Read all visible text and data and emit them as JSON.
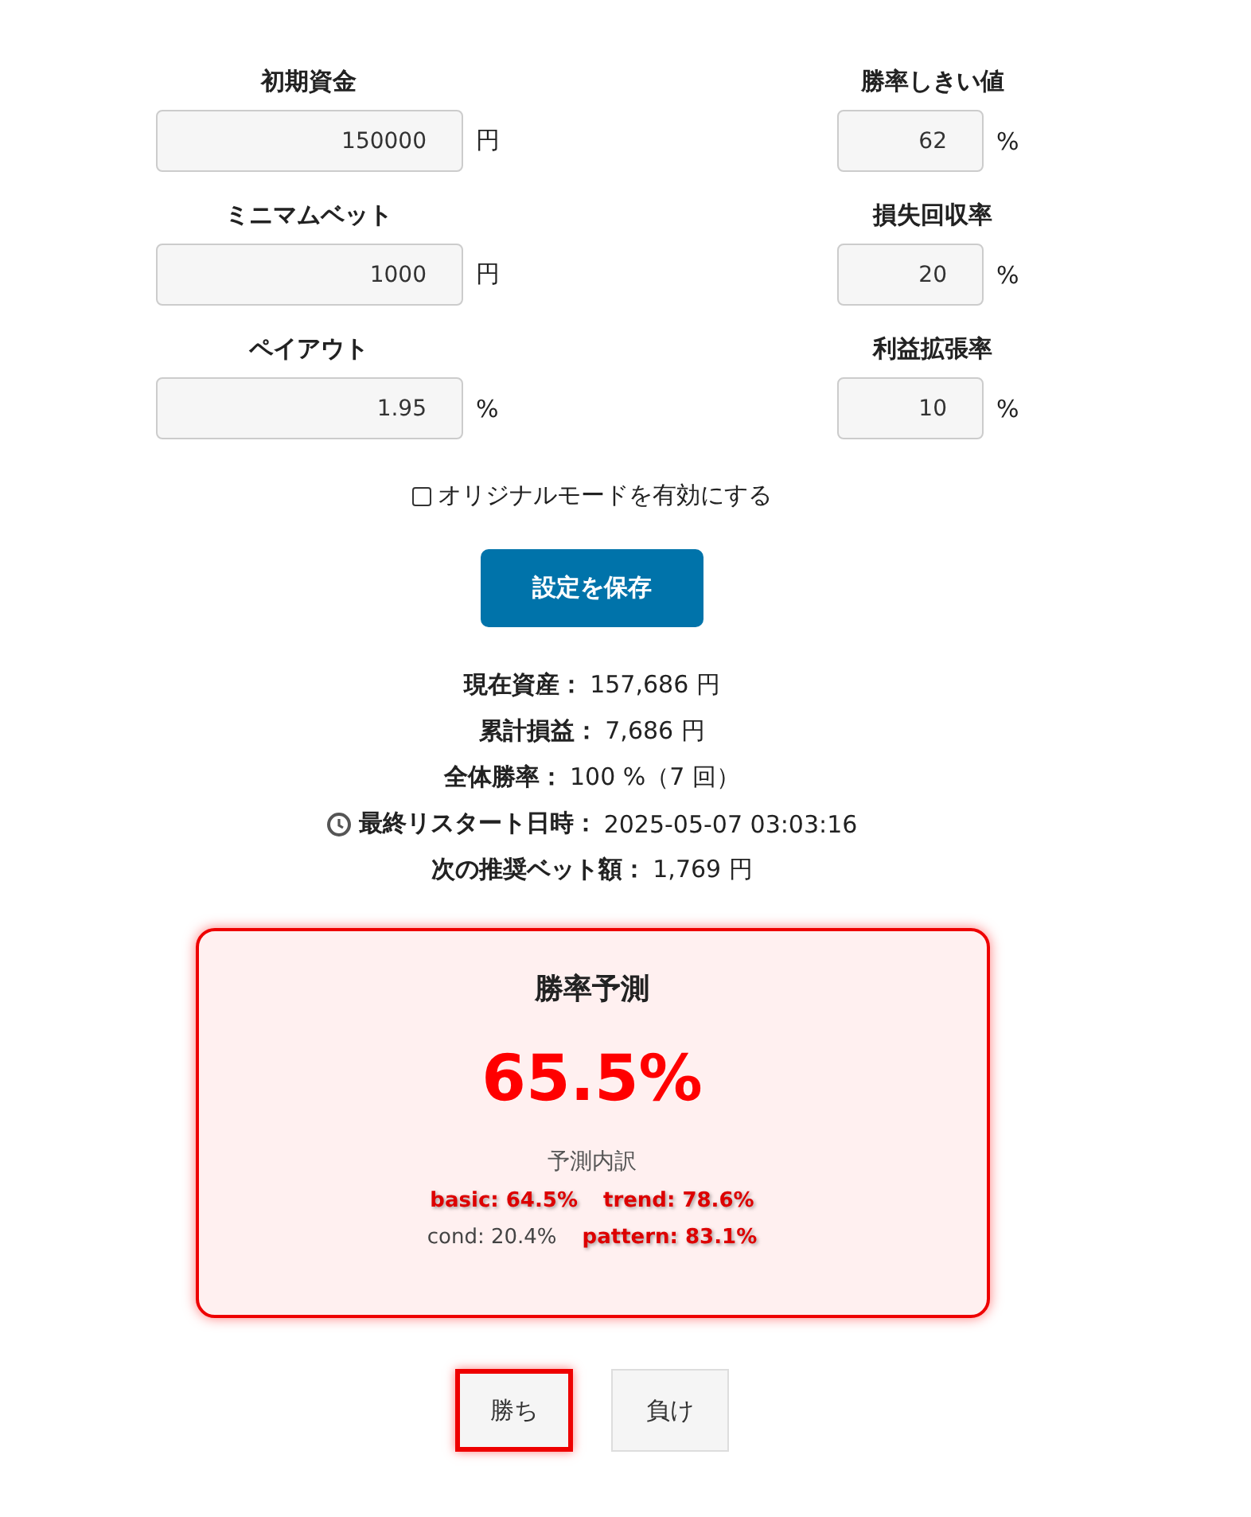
{
  "settings": {
    "left": [
      {
        "label": "初期資金",
        "value": "150000",
        "unit": "円"
      },
      {
        "label": "ミニマムベット",
        "value": "1000",
        "unit": "円"
      },
      {
        "label": "ペイアウト",
        "value": "1.95",
        "unit": "%"
      }
    ],
    "right": [
      {
        "label": "勝率しきい値",
        "value": "62",
        "unit": "%"
      },
      {
        "label": "損失回収率",
        "value": "20",
        "unit": "%"
      },
      {
        "label": "利益拡張率",
        "value": "10",
        "unit": "%"
      }
    ]
  },
  "original_mode": {
    "label": "オリジナルモードを有効にする",
    "checked": false
  },
  "save_button": "設定を保存",
  "stats": [
    {
      "kind": "plain",
      "label": "現在資産：",
      "value": "157,686 円"
    },
    {
      "kind": "plain",
      "label": "累計損益：",
      "value": "7,686 円"
    },
    {
      "kind": "plain",
      "label": "全体勝率：",
      "value": "100 %（7 回）"
    },
    {
      "kind": "time",
      "label": "最終リスタート日時：",
      "value": "2025-05-07 03:03:16"
    },
    {
      "kind": "plain",
      "label": "次の推奨ベット額：",
      "value": "1,769 円"
    }
  ],
  "prediction": {
    "title": "勝率予測",
    "value": "65.5%",
    "breakdown_title": "予測内訳",
    "breakdown": [
      [
        {
          "text": "basic: 64.5%",
          "highlighted": true
        },
        {
          "text": "trend: 78.6%",
          "highlighted": true
        }
      ],
      [
        {
          "text": "cond: 20.4%",
          "highlighted": false
        },
        {
          "text": "pattern: 83.1%",
          "highlighted": true
        }
      ]
    ]
  },
  "result_buttons": [
    {
      "label": "勝ち",
      "selected": true
    },
    {
      "label": "負け",
      "selected": false
    }
  ]
}
